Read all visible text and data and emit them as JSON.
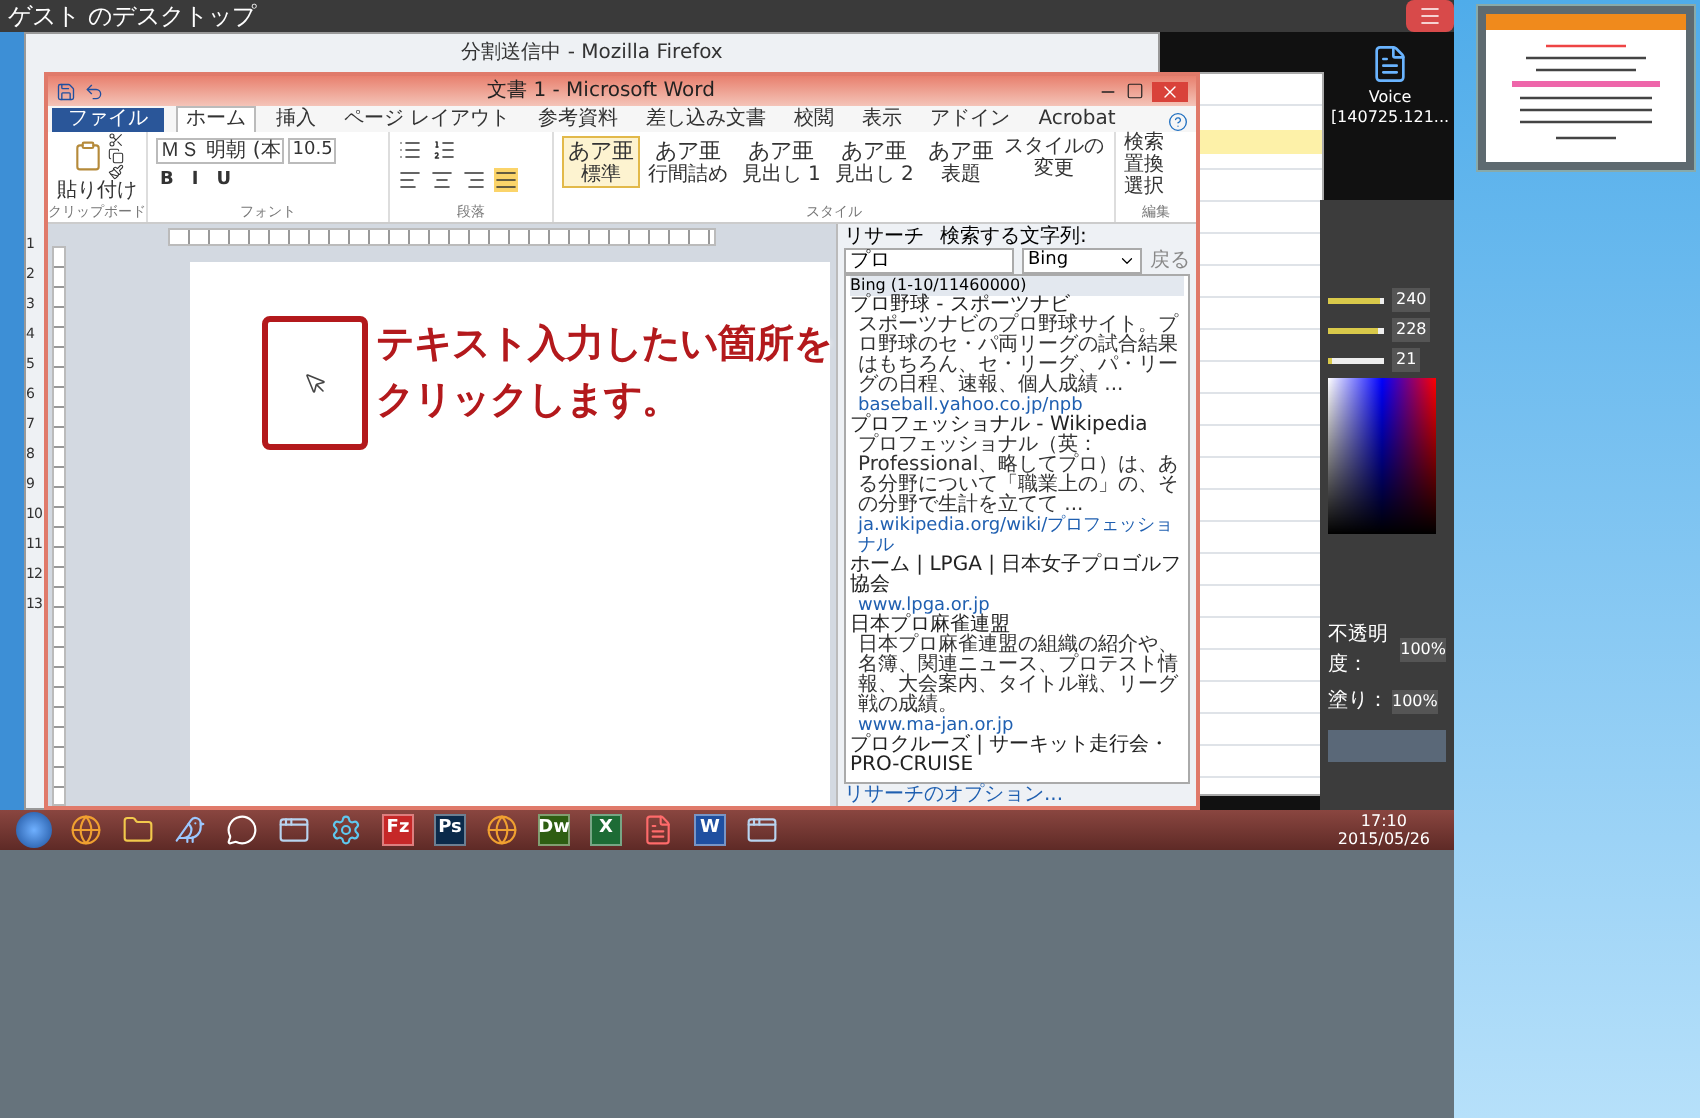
{
  "viewer": {
    "title": "ゲスト のデスクトップ"
  },
  "firefox": {
    "title": "分割送信中 - Mozilla Firefox",
    "row_numbers": [
      "1",
      "2",
      "3",
      "4",
      "5",
      "6",
      "7",
      "8",
      "9",
      "10",
      "11",
      "12",
      "13"
    ]
  },
  "word": {
    "title": "文書 1 - Microsoft Word",
    "tabs": [
      {
        "label": "ファイル",
        "kind": "file",
        "selected": false
      },
      {
        "label": "ホーム",
        "kind": "tab",
        "selected": true
      },
      {
        "label": "挿入",
        "kind": "tab",
        "selected": false
      },
      {
        "label": "ページ レイアウト",
        "kind": "tab",
        "selected": false
      },
      {
        "label": "参考資料",
        "kind": "tab",
        "selected": false
      },
      {
        "label": "差し込み文書",
        "kind": "tab",
        "selected": false
      },
      {
        "label": "校閲",
        "kind": "tab",
        "selected": false
      },
      {
        "label": "表示",
        "kind": "tab",
        "selected": false
      },
      {
        "label": "アドイン",
        "kind": "tab",
        "selected": false
      },
      {
        "label": "Acrobat",
        "kind": "tab",
        "selected": false
      }
    ],
    "paste_label": "貼り付け",
    "font_name": "ＭＳ 明朝 (本",
    "font_size": "10.5",
    "format_buttons": [
      "B",
      "I",
      "U"
    ],
    "styles": [
      {
        "sample": "あア亜",
        "label": "標準",
        "selected": true
      },
      {
        "sample": "あア亜",
        "label": "行間詰め",
        "selected": false
      },
      {
        "sample": "あア亜",
        "label": "見出し 1",
        "selected": false
      },
      {
        "sample": "あア亜",
        "label": "見出し 2",
        "selected": false
      },
      {
        "sample": "あア亜",
        "label": "表題",
        "selected": false
      }
    ],
    "change_styles": "スタイルの変更",
    "edit_items": [
      "検索",
      "置換",
      "選択"
    ],
    "group_labels": [
      "クリップボード",
      "フォント",
      "段落",
      "スタイル",
      "編集"
    ]
  },
  "callout": {
    "lines": [
      "テキスト入力したい箇所を",
      "クリックします。"
    ]
  },
  "research": {
    "title": "リサーチ",
    "search_label": "検索する文字列:",
    "query": "プロ",
    "source": "Bing",
    "back": "戻る",
    "results_header": "Bing (1-10/11460000)",
    "results": [
      {
        "title": "プロ野球 - スポーツナビ",
        "description": "スポーツナビのプロ野球サイト。プロ野球のセ・パ両リーグの試合結果はもちろん、セ・リーグ、パ・リーグの日程、速報、個人成績 ...",
        "url": "baseball.yahoo.co.jp/npb"
      },
      {
        "title": "プロフェッショナル - Wikipedia",
        "description": "プロフェッショナル（英：Professional、略してプロ）は、ある分野について「職業上の」の、その分野で生計を立てて ...",
        "url": "ja.wikipedia.org/wiki/プロフェッショナル"
      },
      {
        "title": "ホーム | LPGA | 日本女子プロゴルフ協会",
        "url": "www.lpga.or.jp"
      },
      {
        "title": "日本プロ麻雀連盟",
        "description": "日本プロ麻雀連盟の組織の紹介や、名簿、関連ニュース、プロテスト情報、大会案内、タイトル戦、リーグ戦の成績。",
        "url": "www.ma-jan.or.jp"
      },
      {
        "title": "プロクルーズ | サーキット走行会・PRO-CRUISE"
      }
    ],
    "options": "リサーチのオプション..."
  },
  "desktop": {
    "icon_label": "Voice [140725.121..."
  },
  "photoshop": {
    "sliders": [
      {
        "value": "240",
        "level": 0.92
      },
      {
        "value": "228",
        "level": 0.88
      },
      {
        "value": "21",
        "level": 0.08
      }
    ],
    "opacity_label": "不透明度：",
    "opacity": "100%",
    "fill_label": "塗り：",
    "fill": "100%"
  },
  "taskbar": {
    "apps": [
      {
        "kind": "start"
      },
      {
        "kind": "globe"
      },
      {
        "kind": "folder"
      },
      {
        "kind": "bird"
      },
      {
        "kind": "chat"
      },
      {
        "kind": "window"
      },
      {
        "kind": "gear"
      },
      {
        "kind": "letters",
        "label": "Fz",
        "color": "#c62828"
      },
      {
        "kind": "letters",
        "label": "Ps",
        "color": "#0b2a4a"
      },
      {
        "kind": "globe"
      },
      {
        "kind": "letters",
        "label": "Dw",
        "color": "#2e5e12"
      },
      {
        "kind": "letters",
        "label": "X",
        "color": "#1d6b35"
      },
      {
        "kind": "pdf"
      },
      {
        "kind": "letters",
        "label": "W",
        "color": "#1f4fa0"
      },
      {
        "kind": "window"
      }
    ],
    "time": "17:10",
    "date": "2015/05/26"
  }
}
